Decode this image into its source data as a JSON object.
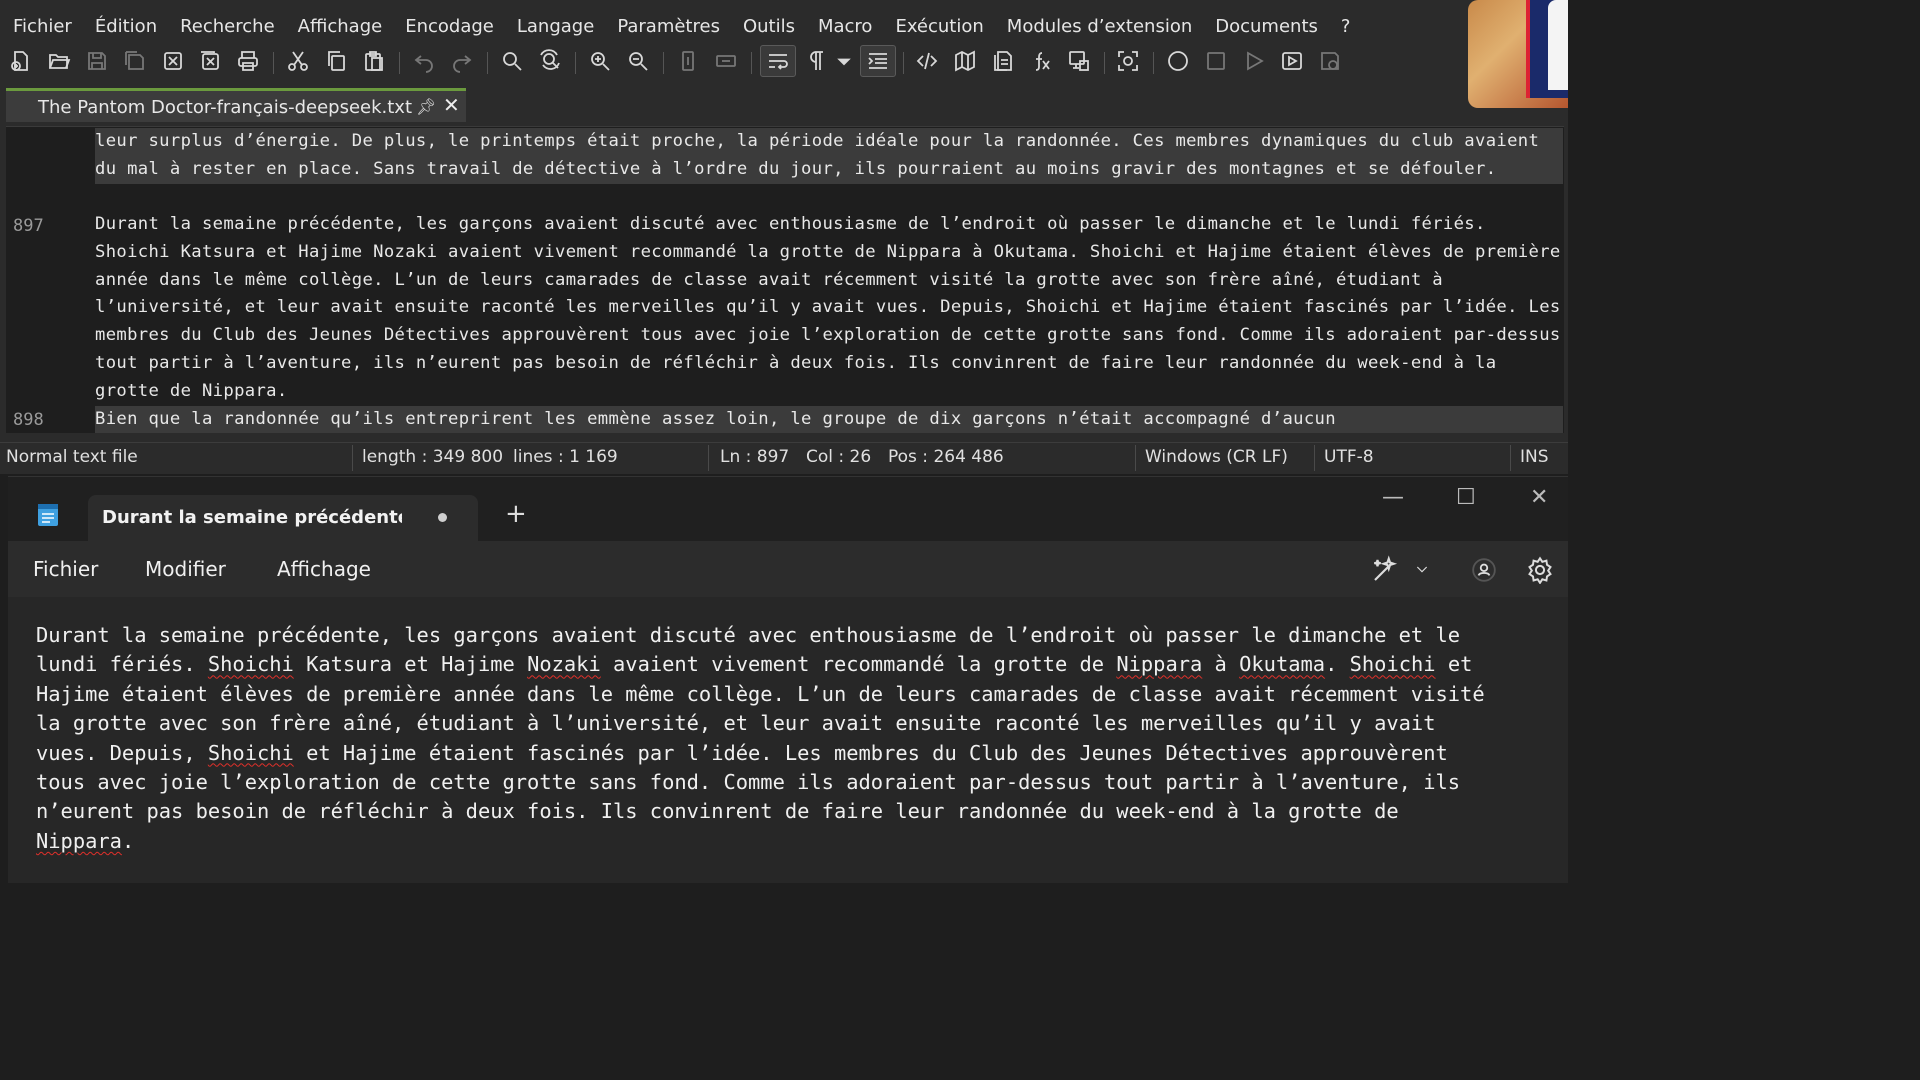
{
  "npp": {
    "menu": [
      "Fichier",
      "Édition",
      "Recherche",
      "Affichage",
      "Encodage",
      "Langage",
      "Paramètres",
      "Outils",
      "Macro",
      "Exécution",
      "Modules d’extension",
      "Documents",
      "?"
    ],
    "tab": {
      "title": "The Pantom Doctor-français-deepseek.txt"
    },
    "editor": {
      "line_prev_text": "leur surplus d’énergie. De plus, le printemps était proche, la période idéale pour la randonnée. Ces membres dynamiques du club avaient du mal à rester en place. Sans travail de détective à l’ordre du jour, ils pourraient au moins gravir des montagnes et se défouler.",
      "line_897_no": "897",
      "line_897_text": "Durant la semaine précédente, les garçons avaient discuté avec enthousiasme de l’endroit où passer le dimanche et le lundi fériés. Shoichi Katsura et Hajime Nozaki avaient vivement recommandé la grotte de Nippara à Okutama. Shoichi et Hajime étaient élèves de première année dans le même collège. L’un de leurs camarades de classe avait récemment visité la grotte avec son frère aîné, étudiant à l’université, et leur avait ensuite raconté les merveilles qu’il y avait vues. Depuis, Shoichi et Hajime étaient fascinés par l’idée. Les membres du Club des Jeunes Détectives approuvèrent tous avec joie l’exploration de cette grotte sans fond. Comme ils adoraient par-dessus tout partir à l’aventure, ils n’eurent pas besoin de réfléchir à deux fois. Ils convinrent de faire leur randonnée du week-end à la grotte de Nippara.",
      "line_898_no": "898",
      "line_898_text": "Bien que la randonnée qu’ils entreprirent les emmène assez loin, le groupe de dix garçons n’était accompagné d’aucun"
    },
    "status": {
      "file_type": "Normal text file",
      "length": "length : 349 800",
      "lines": "lines : 1 169",
      "ln": "Ln : 897",
      "col": "Col : 26",
      "pos": "Pos : 264 486",
      "eol": "Windows (CR LF)",
      "encoding": "UTF-8",
      "mode": "INS"
    }
  },
  "notepad": {
    "tab_title": "Durant la semaine précédente, les garçons",
    "menu": {
      "file": "Fichier",
      "edit": "Modifier",
      "view": "Affichage"
    },
    "content": {
      "l1": "Durant la semaine précédente, les garçons avaient discuté avec enthousiasme de l’endroit où passer le dimanche et le",
      "l2a": "lundi fériés. ",
      "l2b": "Shoichi",
      "l2c": " Katsura et Hajime ",
      "l2d": "Nozaki",
      "l2e": " avaient vivement recommandé la grotte de ",
      "l2f": "Nippara",
      "l2g": " à ",
      "l2h": "Okutama",
      "l2i": ". ",
      "l2j": "Shoichi",
      "l2k": " et",
      "l3": "Hajime étaient élèves de première année dans le même collège. L’un de leurs camarades de classe avait récemment visité",
      "l4": "la grotte avec son frère aîné, étudiant à l’université, et leur avait ensuite raconté les merveilles qu’il y avait",
      "l5a": "vues. Depuis, ",
      "l5b": "Shoichi",
      "l5c": " et Hajime étaient fascinés par l’idée. Les membres du Club des Jeunes Détectives approuvèrent",
      "l6": "tous avec joie l’exploration de cette grotte sans fond. Comme ils adoraient par-dessus tout partir à l’aventure, ils",
      "l7": "n’eurent pas besoin de réfléchir à deux fois. Ils convinrent de faire leur randonnée du week-end à la grotte de",
      "l8a": "Nippara",
      "l8b": "."
    }
  }
}
